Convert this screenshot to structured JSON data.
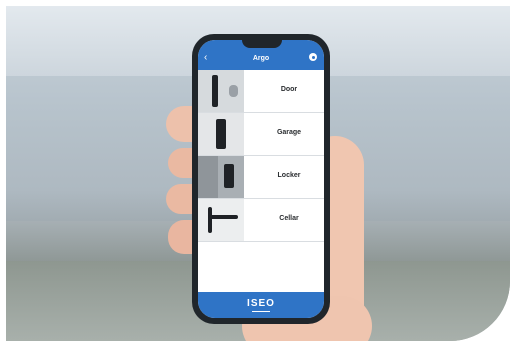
{
  "app": {
    "title": "Argo",
    "back_icon": "chevron-left-icon",
    "settings_icon": "gear-icon",
    "accent_color": "#2f74c6"
  },
  "locks": [
    {
      "label": "Door"
    },
    {
      "label": "Garage"
    },
    {
      "label": "Locker"
    },
    {
      "label": "Cellar"
    }
  ],
  "footer": {
    "brand": "ISEO"
  }
}
